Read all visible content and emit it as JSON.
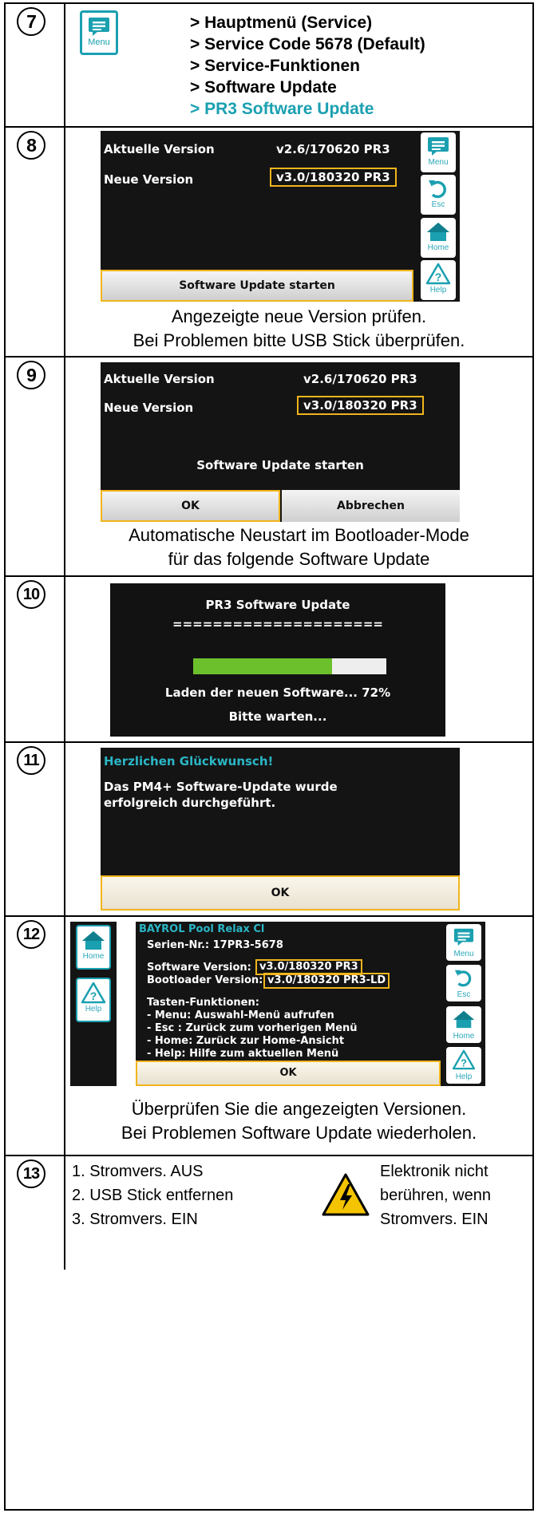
{
  "steps": [
    {
      "number": "7",
      "menu_icon_label": "Menu",
      "menu_path": [
        "> Hauptmenü (Service)",
        "> Service Code 5678 (Default)",
        "> Service-Funktionen",
        "> Software Update",
        "> PR3 Software Update"
      ]
    },
    {
      "number": "8",
      "screen": {
        "current_label": "Aktuelle Version",
        "current_value": "v2.6/170620 PR3",
        "new_label": "Neue Version",
        "new_value": "v3.0/180320 PR3",
        "start_button": "Software Update starten",
        "side_buttons": [
          "Menu",
          "Esc",
          "Home",
          "Help"
        ]
      },
      "caption": [
        "Angezeigte neue Version prüfen.",
        "Bei Problemen bitte USB Stick überprüfen."
      ]
    },
    {
      "number": "9",
      "screen": {
        "current_label": "Aktuelle Version",
        "current_value": "v2.6/170620 PR3",
        "new_label": "Neue Version",
        "new_value": "v3.0/180320 PR3",
        "message": "Software Update starten",
        "ok": "OK",
        "cancel": "Abbrechen"
      },
      "caption": [
        "Automatische Neustart im Bootloader-Mode",
        "für das folgende Software Update"
      ]
    },
    {
      "number": "10",
      "screen": {
        "title": "PR3 Software Update",
        "separator": "=====================",
        "progress": 0.72,
        "loading_text": "Laden der neuen Software...  72%",
        "wait_text": "Bitte warten..."
      }
    },
    {
      "number": "11",
      "screen": {
        "heading": "Herzlichen Glückwunsch!",
        "message_line1": "Das PM4+ Software-Update wurde",
        "message_line2": "erfolgreich durchgeführt.",
        "ok": "OK"
      }
    },
    {
      "number": "12",
      "left_buttons": [
        "Home",
        "Help"
      ],
      "screen": {
        "product": "BAYROL Pool Relax Cl",
        "serial": "Serien-Nr.: 17PR3-5678",
        "sw_label": "Software Version:",
        "sw_value": "v3.0/180320 PR3",
        "bl_label": "Bootloader Version:",
        "bl_value": "v3.0/180320 PR3-LD",
        "keys_title": "Tasten-Funktionen:",
        "keys": [
          "- Menu: Auswahl-Menü aufrufen",
          "- Esc : Zurück zum vorherigen Menü",
          "- Home: Zurück zur Home-Ansicht",
          "- Help: Hilfe zum aktuellen Menü"
        ],
        "ok": "OK",
        "side_buttons": [
          "Menu",
          "Esc",
          "Home",
          "Help"
        ]
      },
      "caption": [
        "Überprüfen Sie die angezeigten Versionen.",
        "Bei Problemen Software Update wiederholen."
      ]
    },
    {
      "number": "13",
      "instructions": [
        "1. Stromvers. AUS",
        "2. USB Stick entfernen",
        "3. Stromvers. EIN"
      ],
      "warning": [
        "Elektronik nicht",
        "berühren, wenn",
        "Stromvers. EIN"
      ]
    }
  ],
  "colors": {
    "accent": "#f1b51c",
    "teal": "#1aa0b0",
    "screen": "#141414",
    "progress": "#6cc02c"
  }
}
